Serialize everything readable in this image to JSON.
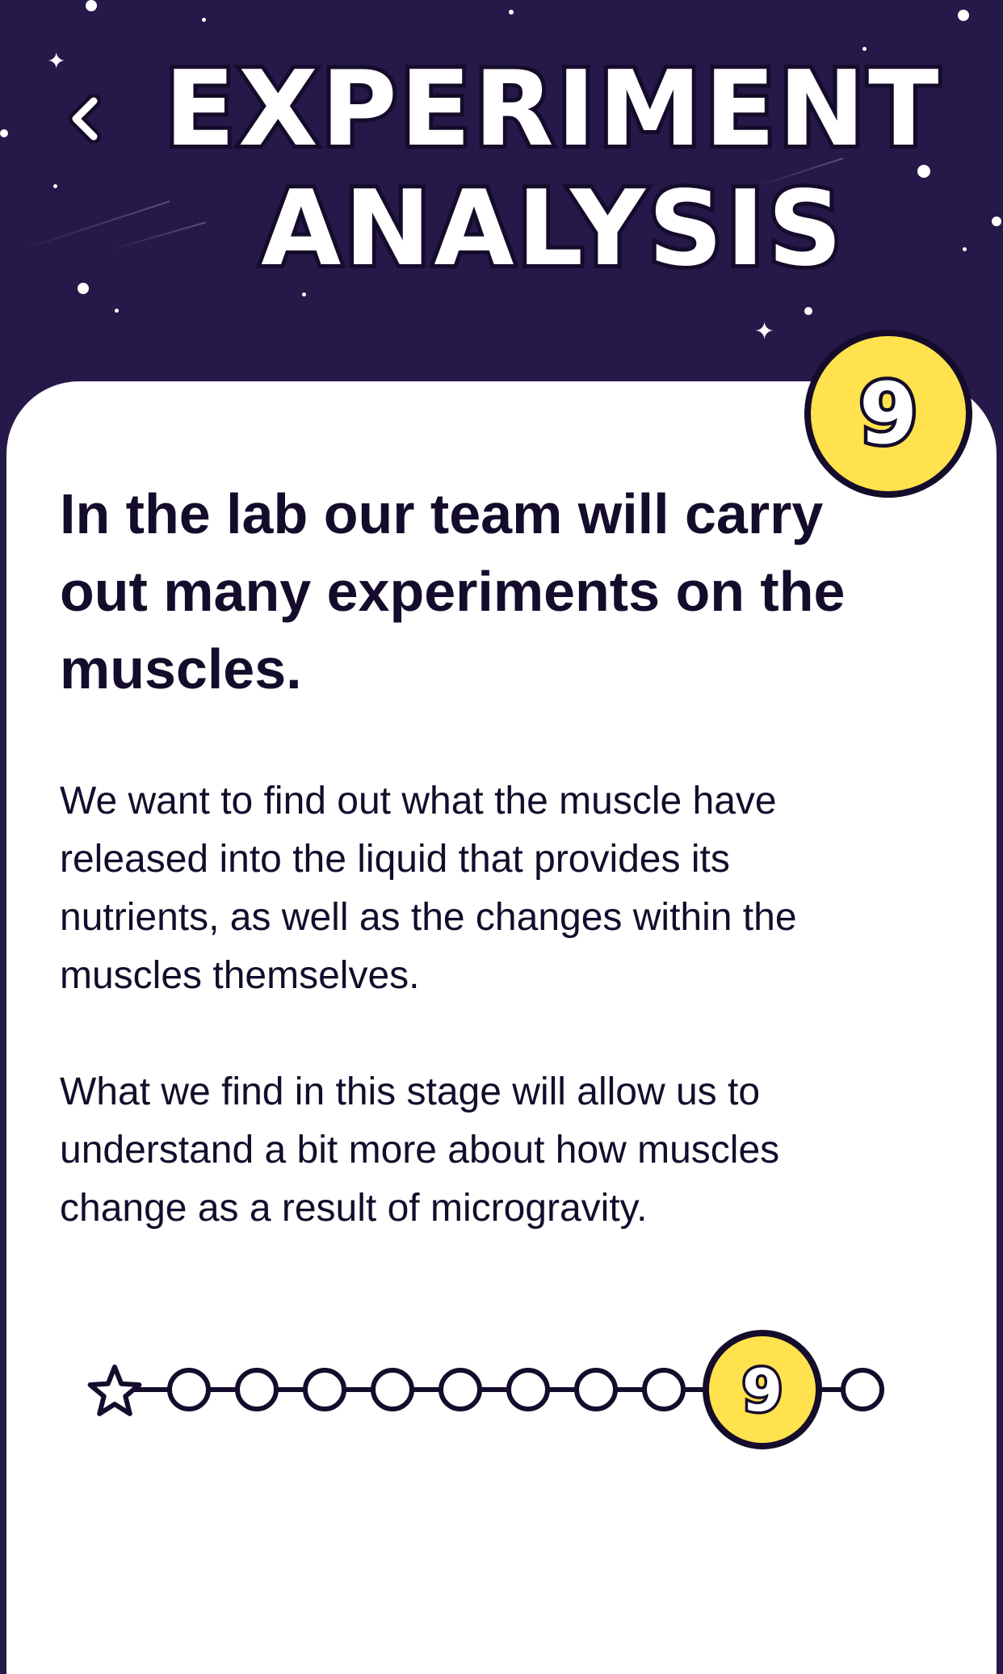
{
  "header": {
    "title_lines": [
      "Experiment",
      "Analysis"
    ],
    "back_icon": "chevron-left-icon"
  },
  "stage": {
    "number": "9"
  },
  "content": {
    "heading": "In the lab our team will carry out many experiments on the muscles.",
    "paragraph_1": "We want to find out what the muscle have released into the liquid that provides its nutrients, as well as the changes within the muscles themselves.",
    "paragraph_2": "What we find in this stage will allow us to understand a bit more about how muscles change as a result of microgravity."
  },
  "progress": {
    "start_icon": "star-icon",
    "total_steps": 11,
    "current_step": 9,
    "current_label": "9"
  },
  "colors": {
    "background": "#261848",
    "card": "#ffffff",
    "text": "#150c2c",
    "accent_yellow": "#ffe24d"
  }
}
